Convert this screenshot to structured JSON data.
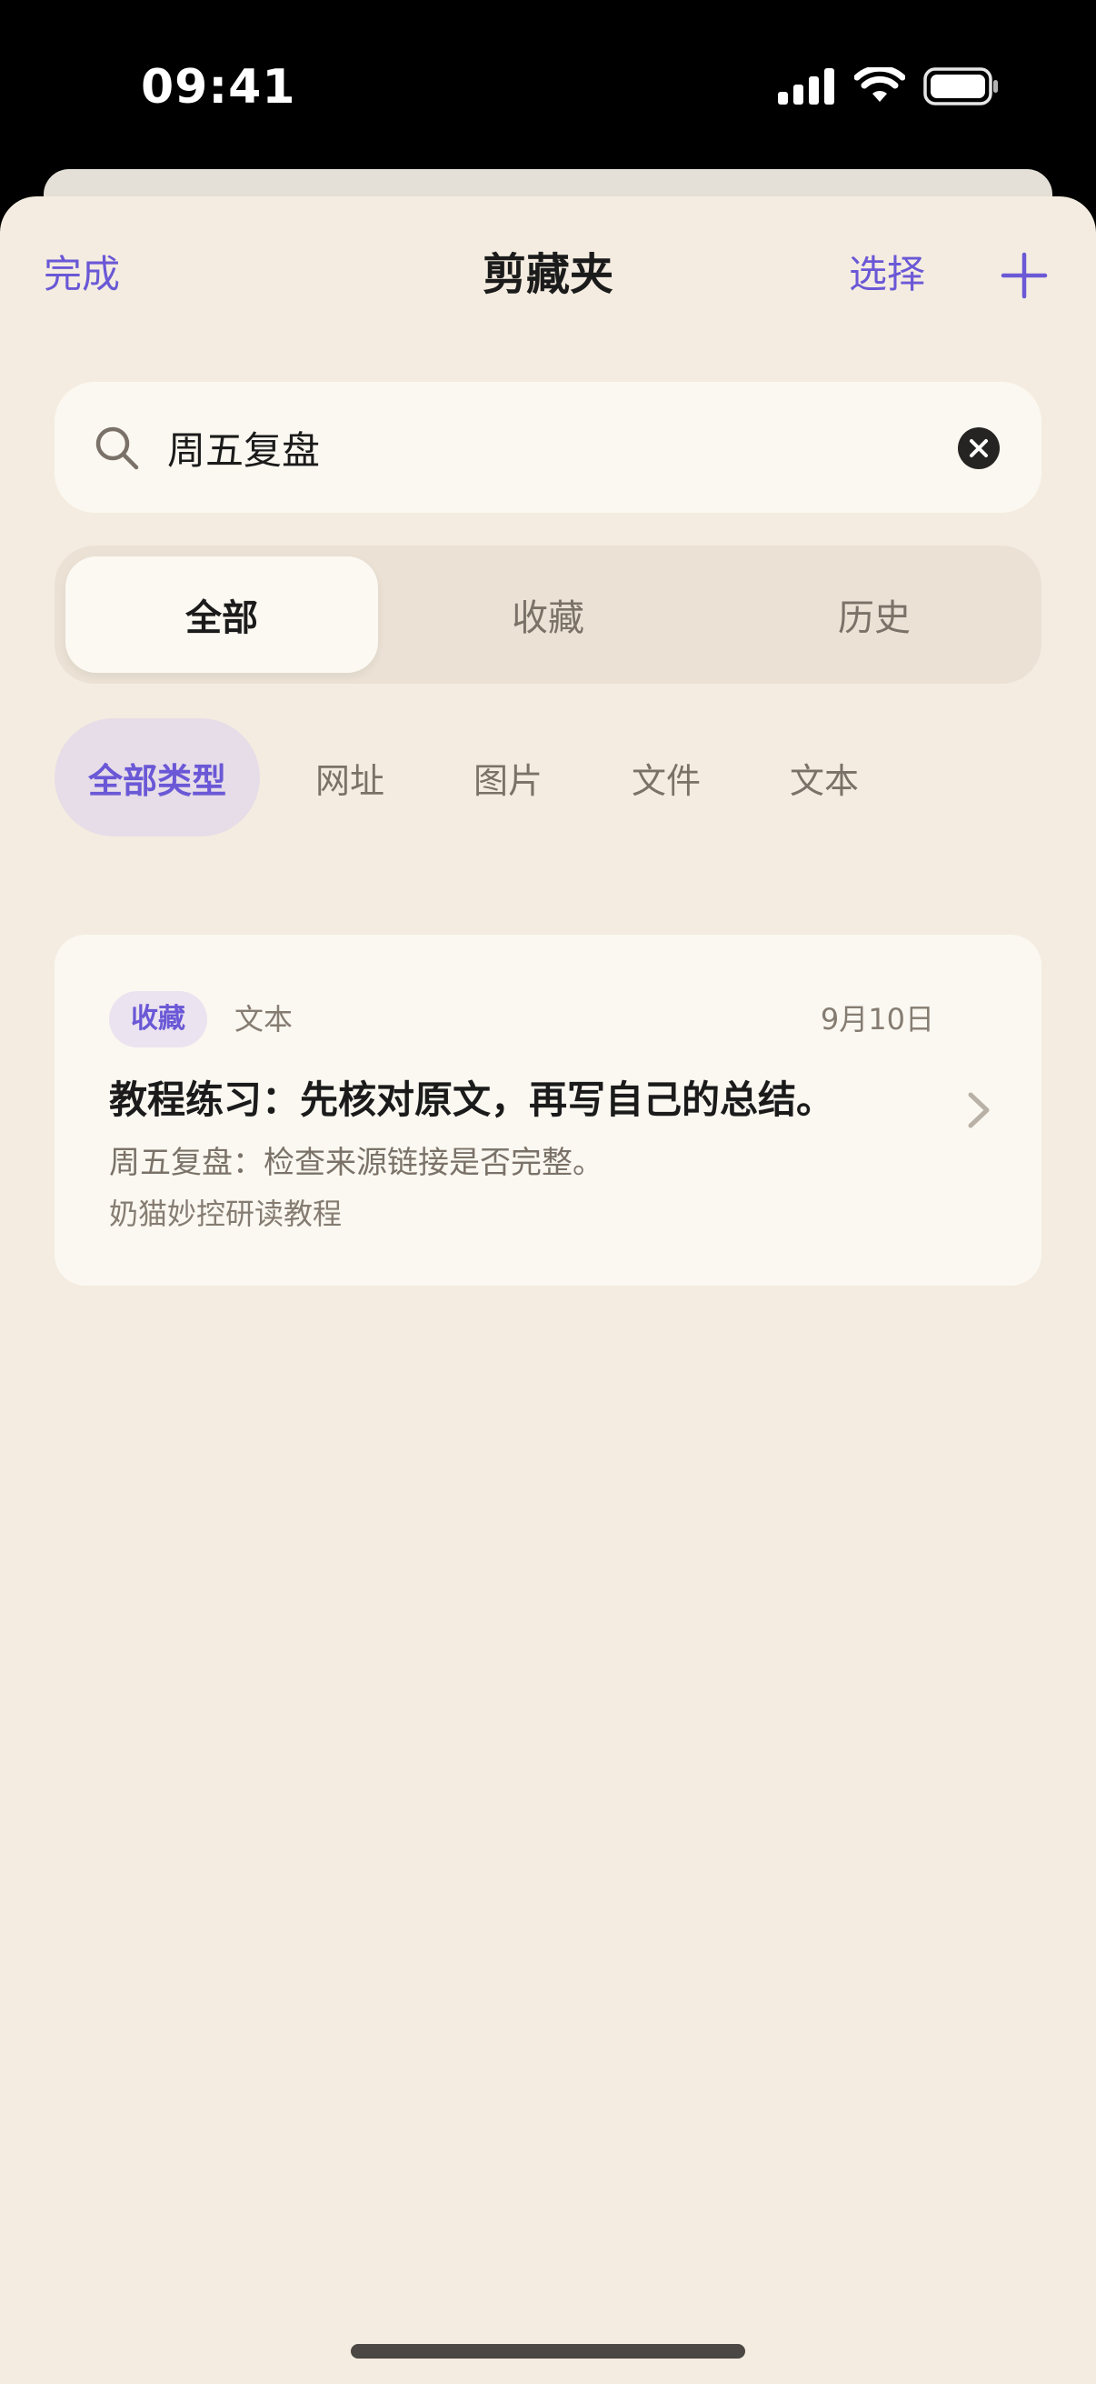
{
  "status_bar": {
    "time": "09:41"
  },
  "nav": {
    "done_label": "完成",
    "title": "剪藏夹",
    "select_label": "选择",
    "add_icon": "plus-icon"
  },
  "search": {
    "value": "周五复盘",
    "placeholder": "搜索"
  },
  "segments": [
    {
      "label": "全部",
      "active": true
    },
    {
      "label": "收藏",
      "active": false
    },
    {
      "label": "历史",
      "active": false
    }
  ],
  "type_filters": [
    {
      "label": "全部类型",
      "active": true
    },
    {
      "label": "网址",
      "active": false
    },
    {
      "label": "图片",
      "active": false
    },
    {
      "label": "文件",
      "active": false
    },
    {
      "label": "文本",
      "active": false
    }
  ],
  "clips": [
    {
      "tag": "收藏",
      "type": "文本",
      "date": "9月10日",
      "title": "教程练习：先核对原文，再写自己的总结。",
      "snippet": "周五复盘：检查来源链接是否完整。",
      "source": "奶猫妙控研读教程"
    }
  ],
  "colors": {
    "accent": "#6a58d6",
    "background": "#f4ece0",
    "card": "#fbf8f1"
  }
}
